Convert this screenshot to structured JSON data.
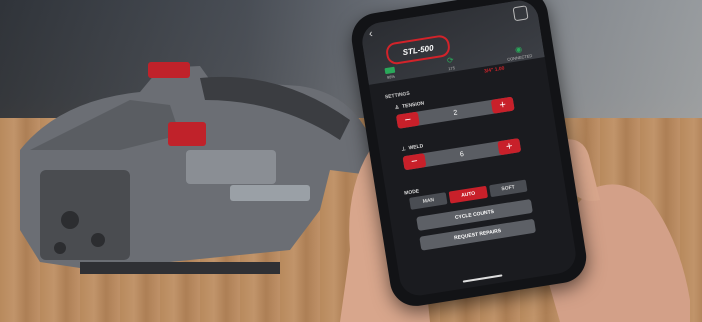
{
  "app": {
    "logo_text": "STL-500",
    "stats": [
      {
        "label": "98%"
      },
      {
        "label": "175"
      },
      {
        "label": "CONNECTED"
      }
    ],
    "strap_size": "3/4\" 1.00",
    "settings_title": "SETTINGS",
    "tension": {
      "label": "TENSION",
      "value": "2",
      "minus": "−",
      "plus": "+"
    },
    "weld": {
      "label": "WELD",
      "value": "6",
      "minus": "−",
      "plus": "+"
    },
    "mode": {
      "label": "MODE",
      "options": [
        "MAN",
        "AUTO",
        "SOFT"
      ],
      "selected": "AUTO"
    },
    "buttons": {
      "cycle_counts": "CYCLE COUNTS",
      "request_repairs": "REQUEST REPAIRS"
    }
  },
  "colors": {
    "accent": "#c8202a",
    "battery": "#2aa85a"
  }
}
